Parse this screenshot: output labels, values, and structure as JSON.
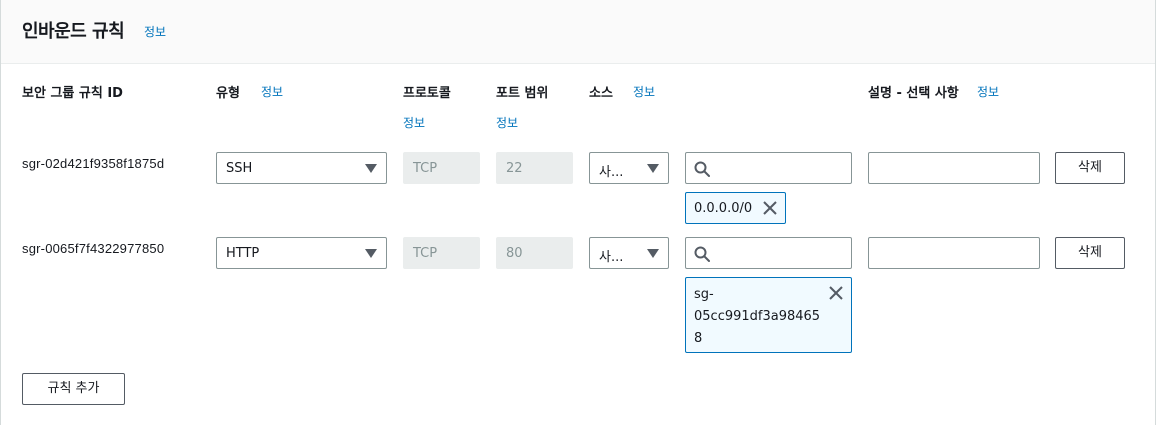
{
  "header": {
    "title": "인바운드 규칙",
    "info": "정보"
  },
  "columns": {
    "rule_id": "보안 그룹 규칙 ID",
    "type": "유형",
    "type_info": "정보",
    "protocol": "프로토콜",
    "protocol_info": "정보",
    "port_range": "포트 범위",
    "port_info": "정보",
    "source": "소스",
    "source_info": "정보",
    "description": "설명 - 선택 사항",
    "description_info": "정보"
  },
  "rules": [
    {
      "id": "sgr-02d421f9358f1875d",
      "type": "SSH",
      "protocol": "TCP",
      "port": "22",
      "source_type": "사...",
      "source_tokens": [
        "0.0.0.0/0"
      ],
      "delete_label": "삭제"
    },
    {
      "id": "sgr-0065f7f4322977850",
      "type": "HTTP",
      "protocol": "TCP",
      "port": "80",
      "source_type": "사...",
      "source_tokens": [
        "sg-",
        "05cc991df3a98465",
        "8"
      ],
      "delete_label": "삭제"
    }
  ],
  "add_rule_label": "규칙 추가"
}
